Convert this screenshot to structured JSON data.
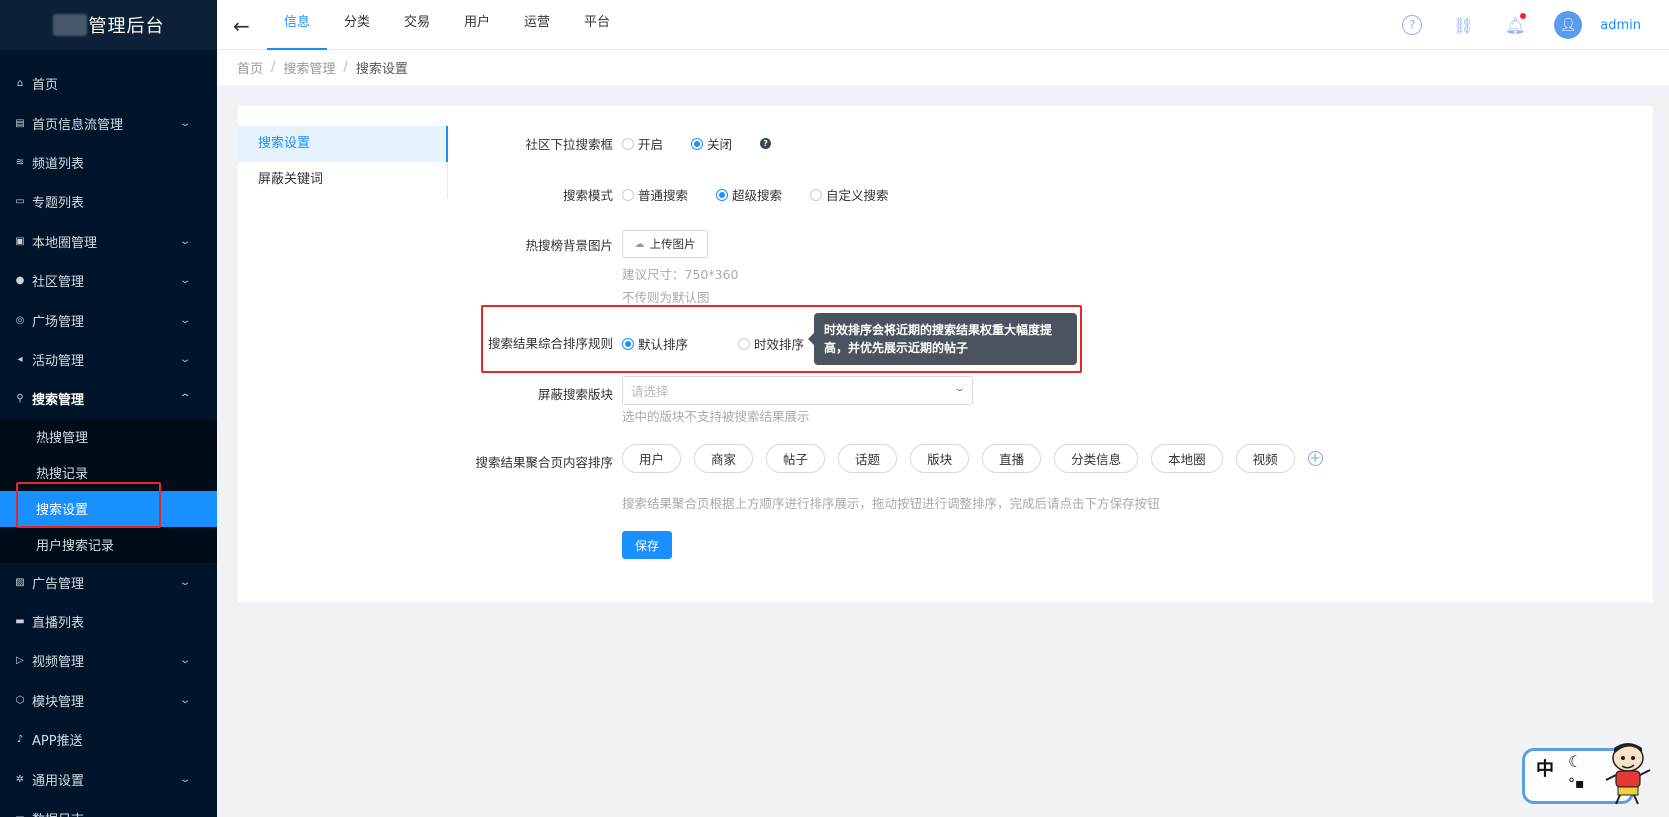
{
  "app": {
    "logo_text": "管理后台"
  },
  "sidebar": {
    "items": [
      {
        "label": "首页",
        "icon": "home-icon",
        "glyph": "⌂",
        "has_children": false
      },
      {
        "label": "首页信息流管理",
        "icon": "document-icon",
        "glyph": "▤",
        "has_children": true
      },
      {
        "label": "频道列表",
        "icon": "rss-icon",
        "glyph": "≋",
        "has_children": false
      },
      {
        "label": "专题列表",
        "icon": "folder-icon",
        "glyph": "▭",
        "has_children": false
      },
      {
        "label": "本地圈管理",
        "icon": "image-icon",
        "glyph": "▣",
        "has_children": true
      },
      {
        "label": "社区管理",
        "icon": "user-circle-icon",
        "glyph": "●",
        "has_children": true
      },
      {
        "label": "广场管理",
        "icon": "compass-icon",
        "glyph": "◎",
        "has_children": true
      },
      {
        "label": "活动管理",
        "icon": "megaphone-icon",
        "glyph": "◂",
        "has_children": true
      },
      {
        "label": "搜索管理",
        "icon": "search-icon",
        "glyph": "⚲",
        "has_children": true,
        "open": true
      },
      {
        "label": "广告管理",
        "icon": "picture-icon",
        "glyph": "▨",
        "has_children": true
      },
      {
        "label": "直播列表",
        "icon": "tv-icon",
        "glyph": "▬",
        "has_children": false
      },
      {
        "label": "视频管理",
        "icon": "video-icon",
        "glyph": "▷",
        "has_children": true
      },
      {
        "label": "模块管理",
        "icon": "cube-icon",
        "glyph": "⬡",
        "has_children": true
      },
      {
        "label": "APP推送",
        "icon": "bell-icon",
        "glyph": "♪",
        "has_children": false
      },
      {
        "label": "通用设置",
        "icon": "gear-icon",
        "glyph": "✲",
        "has_children": true
      },
      {
        "label": "数据日志",
        "icon": "chart-icon",
        "glyph": "▬",
        "has_children": true
      }
    ],
    "search_submenu": [
      {
        "label": "热搜管理"
      },
      {
        "label": "热搜记录"
      },
      {
        "label": "搜索设置",
        "active": true
      },
      {
        "label": "用户搜索记录"
      }
    ]
  },
  "header": {
    "tabs": [
      "信息",
      "分类",
      "交易",
      "用户",
      "运营",
      "平台"
    ],
    "active_tab": "信息",
    "user_name": "admin"
  },
  "breadcrumb": {
    "home": "首页",
    "parent": "搜索管理",
    "current": "搜索设置"
  },
  "settings_nav": {
    "items": [
      "搜索设置",
      "屏蔽关键词"
    ],
    "active": "搜索设置"
  },
  "form": {
    "community_search": {
      "label": "社区下拉搜索框",
      "options": [
        "开启",
        "关闭"
      ],
      "selected": "关闭"
    },
    "search_mode": {
      "label": "搜索模式",
      "options": [
        "普通搜索",
        "超级搜索",
        "自定义搜索"
      ],
      "selected": "超级搜索"
    },
    "hot_bg": {
      "label": "热搜榜背景图片",
      "upload_label": "上传图片",
      "hint_size": "建议尺寸：750*360",
      "hint_default": "不传则为默认图"
    },
    "sort_rule": {
      "label": "搜索结果综合排序规则",
      "options": [
        "默认排序",
        "时效排序"
      ],
      "selected": "默认排序",
      "tooltip": "时效排序会将近期的搜索结果权重大幅度提高，并优先展示近期的帖子"
    },
    "block_section": {
      "label": "屏蔽搜索版块",
      "placeholder": "请选择",
      "hint": "选中的版块不支持被搜索结果展示"
    },
    "aggregate_order": {
      "label": "搜索结果聚合页内容排序",
      "items": [
        "用户",
        "商家",
        "帖子",
        "话题",
        "版块",
        "直播",
        "分类信息",
        "本地圈",
        "视频"
      ],
      "hint": "搜索结果聚合页根据上方顺序进行排序展示，拖动按钮进行调整排序，完成后请点击下方保存按钮"
    },
    "save_label": "保存"
  },
  "mascot": {
    "char1": "中",
    "char2": "☾",
    "char3": "°。",
    "char4": "👕"
  },
  "colors": {
    "sidebar_bg": "#001529",
    "accent": "#1890ff",
    "highlight_red": "#e5262b"
  }
}
